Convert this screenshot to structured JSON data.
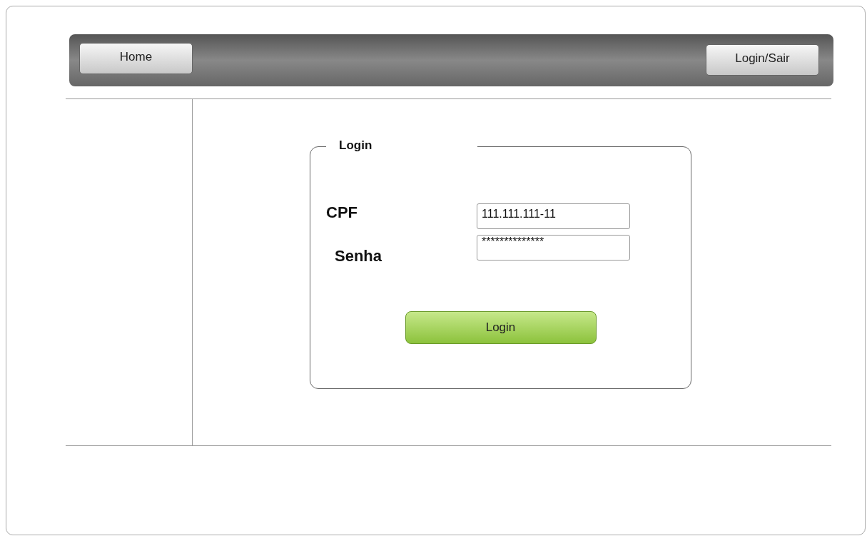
{
  "navbar": {
    "buttons": [
      {
        "label": "Home"
      },
      {
        "label": "Login/Sair"
      }
    ]
  },
  "login_panel": {
    "title": "Login",
    "fields": [
      {
        "label": "CPF",
        "value": "111.111.111-11"
      },
      {
        "label": "Senha",
        "value": "**************"
      }
    ],
    "submit": "Login"
  }
}
